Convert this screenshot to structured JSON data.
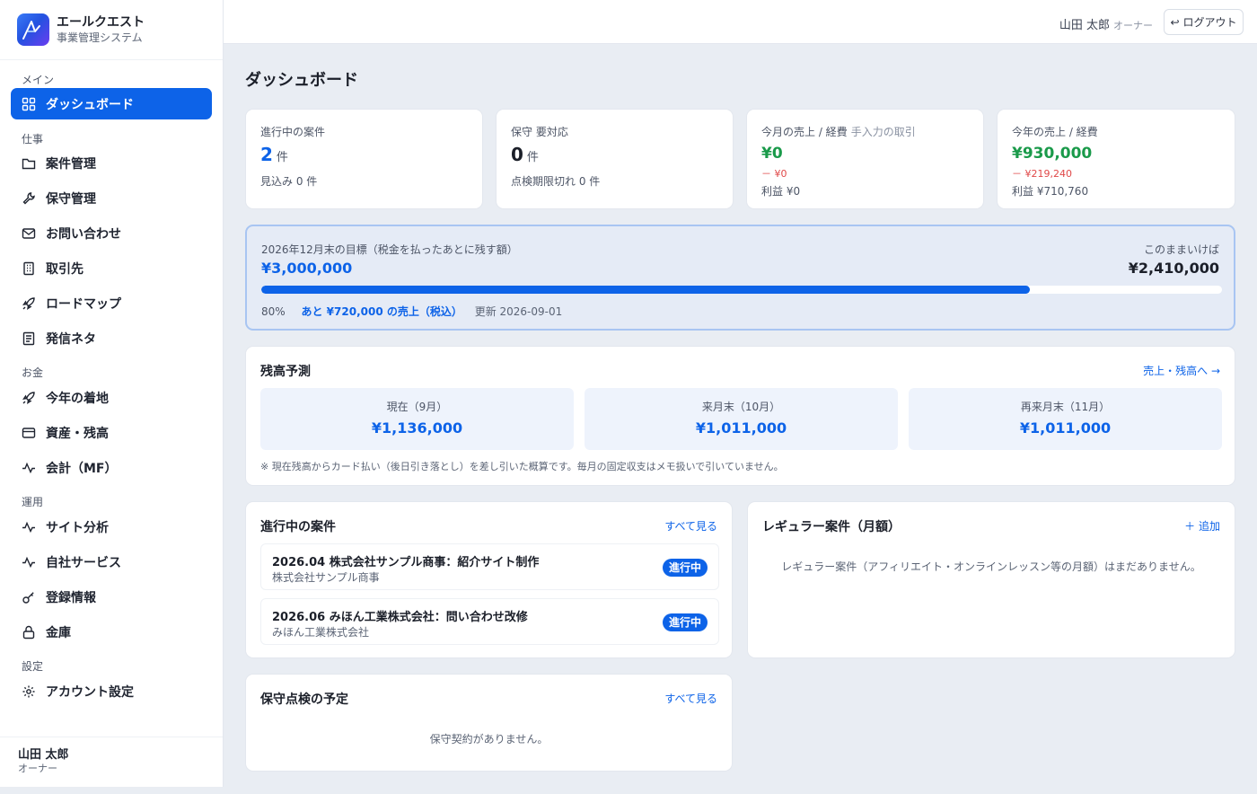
{
  "brand": {
    "name": "エールクエスト",
    "subtitle": "事業管理システム"
  },
  "sidebar": {
    "sections": [
      "メイン",
      "仕事",
      "お金",
      "運用",
      "設定"
    ],
    "items": [
      {
        "label": "ダッシュボード",
        "icon": "grid-icon"
      },
      {
        "label": "案件管理",
        "icon": "folder-icon"
      },
      {
        "label": "保守管理",
        "icon": "wrench-icon"
      },
      {
        "label": "お問い合わせ",
        "icon": "mail-icon"
      },
      {
        "label": "取引先",
        "icon": "building-icon"
      },
      {
        "label": "ロードマップ",
        "icon": "rocket-icon"
      },
      {
        "label": "発信ネタ",
        "icon": "newspaper-icon"
      },
      {
        "label": "今年の着地",
        "icon": "rocket-icon"
      },
      {
        "label": "資産・残高",
        "icon": "wallet-icon"
      },
      {
        "label": "会計（MF）",
        "icon": "activity-icon"
      },
      {
        "label": "サイト分析",
        "icon": "activity-icon"
      },
      {
        "label": "自社サービス",
        "icon": "activity-icon"
      },
      {
        "label": "登録情報",
        "icon": "key-icon"
      },
      {
        "label": "金庫",
        "icon": "lock-icon"
      },
      {
        "label": "アカウント設定",
        "icon": "gear-icon"
      }
    ],
    "user": {
      "name": "山田 太郎",
      "role": "オーナー"
    }
  },
  "header": {
    "user_name": "山田 太郎",
    "user_role": "オーナー",
    "logout_label": "ログアウト"
  },
  "page_title": "ダッシュボード",
  "stats": {
    "projects": {
      "label": "進行中の案件",
      "value": "2",
      "unit": "件",
      "foot": "見込み 0 件"
    },
    "maintenance": {
      "label": "保守 要対応",
      "value": "0",
      "unit": "件",
      "foot": "点検期限切れ 0 件"
    },
    "month": {
      "label": "今月の売上 / 経費",
      "sub": "手入力の取引",
      "sales": "¥0",
      "expense": "－ ¥0",
      "profit": "利益 ¥0"
    },
    "year": {
      "label": "今年の売上 / 経費",
      "sales": "¥930,000",
      "expense": "－ ¥219,240",
      "profit": "利益 ¥710,760"
    }
  },
  "goal": {
    "label": "2026年12月末の目標（税金を払ったあとに残す額）",
    "amount": "¥3,000,000",
    "forecast_label": "このままいけば",
    "forecast_amount": "¥2,410,000",
    "progress": 0.8,
    "percent_text": "80%",
    "remaining_text": "あと ¥720,000 の売上（税込）",
    "updated_text": "更新 2026-09-01"
  },
  "forecast": {
    "title": "残高予測",
    "link": "売上・残高へ →",
    "boxes": [
      {
        "label": "現在（9月）",
        "value": "¥1,136,000"
      },
      {
        "label": "来月末（10月）",
        "value": "¥1,011,000"
      },
      {
        "label": "再来月末（11月）",
        "value": "¥1,011,000"
      }
    ],
    "note": "※ 現在残高からカード払い（後日引き落とし）を差し引いた概算です。毎月の固定収支はメモ扱いで引いていません。"
  },
  "active_projects": {
    "title": "進行中の案件",
    "link": "すべて見る",
    "items": [
      {
        "title": "2026.04 株式会社サンプル商事：紹介サイト制作",
        "client": "株式会社サンプル商事",
        "status": "進行中"
      },
      {
        "title": "2026.06 みほん工業株式会社：問い合わせ改修",
        "client": "みほん工業株式会社",
        "status": "進行中"
      }
    ]
  },
  "regular": {
    "title": "レギュラー案件（月額）",
    "add_label": "＋ 追加",
    "empty": "レギュラー案件（アフィリエイト・オンラインレッスン等の月額）はまだありません。"
  },
  "maintenance_schedule": {
    "title": "保守点検の予定",
    "link": "すべて見る",
    "empty": "保守契約がありません。"
  },
  "colors": {
    "accent": "#0d63e8",
    "positive": "#1a9a4a",
    "negative": "#e04848"
  }
}
